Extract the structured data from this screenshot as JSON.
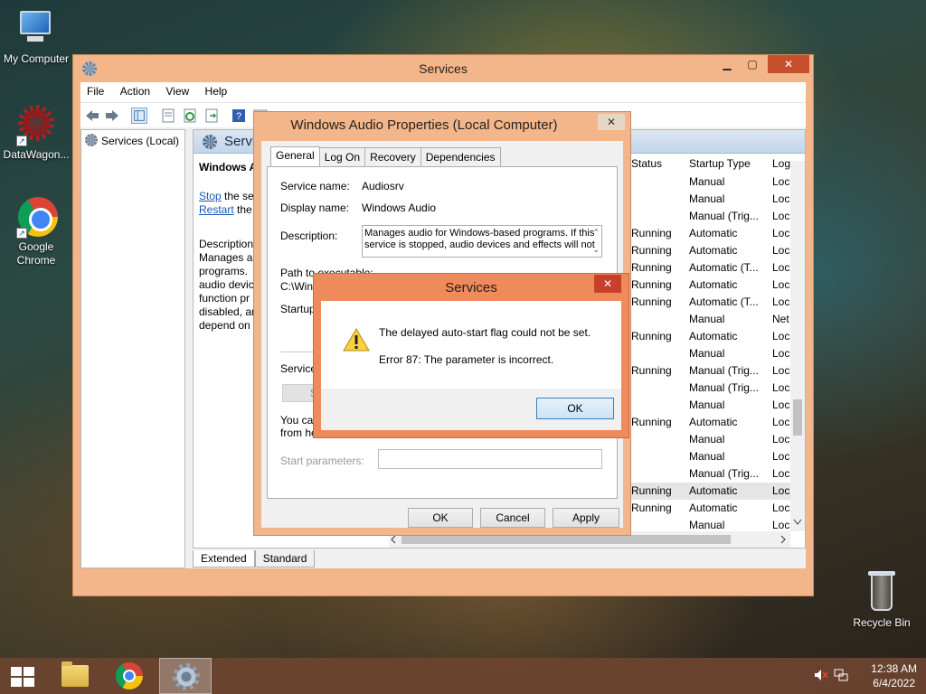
{
  "desktop": {
    "icons": [
      {
        "label": "My Computer"
      },
      {
        "label": "DataWagon..."
      },
      {
        "label": "Google Chrome"
      },
      {
        "label": "Recycle Bin"
      }
    ]
  },
  "services_window": {
    "title": "Services",
    "menu": [
      "File",
      "Action",
      "View",
      "Help"
    ],
    "tree_root": "Services (Local)",
    "detail_header": "Servi",
    "service_title": "Windows A",
    "actions": {
      "stop_link": "Stop",
      "stop_rest": " the ser",
      "restart_link": "Restart",
      "restart_rest": " the"
    },
    "description_lines": [
      "Description",
      "Manages au",
      "programs.",
      "audio devic",
      "function pr",
      "disabled, ar",
      "depend on"
    ],
    "columns": {
      "status": "Status",
      "startup_type": "Startup Type",
      "log_on": "Log"
    },
    "rows": [
      {
        "status": "",
        "startup": "Manual",
        "log": "Loc"
      },
      {
        "status": "",
        "startup": "Manual",
        "log": "Loc"
      },
      {
        "status": "",
        "startup": "Manual (Trig...",
        "log": "Loc"
      },
      {
        "status": "Running",
        "startup": "Automatic",
        "log": "Loc"
      },
      {
        "status": "Running",
        "startup": "Automatic",
        "log": "Loc"
      },
      {
        "status": "Running",
        "startup": "Automatic (T...",
        "log": "Loc"
      },
      {
        "status": "Running",
        "startup": "Automatic",
        "log": "Loc"
      },
      {
        "status": "Running",
        "startup": "Automatic (T...",
        "log": "Loc"
      },
      {
        "status": "",
        "startup": "Manual",
        "log": "Net"
      },
      {
        "status": "Running",
        "startup": "Automatic",
        "log": "Loc"
      },
      {
        "status": "",
        "startup": "Manual",
        "log": "Loc"
      },
      {
        "status": "Running",
        "startup": "Manual (Trig...",
        "log": "Loc"
      },
      {
        "status": "",
        "startup": "Manual (Trig...",
        "log": "Loc"
      },
      {
        "status": "",
        "startup": "Manual",
        "log": "Loc"
      },
      {
        "status": "Running",
        "startup": "Automatic",
        "log": "Loc"
      },
      {
        "status": "",
        "startup": "Manual",
        "log": "Loc"
      },
      {
        "status": "",
        "startup": "Manual",
        "log": "Loc"
      },
      {
        "status": "",
        "startup": "Manual (Trig...",
        "log": "Loc"
      },
      {
        "status": "Running",
        "startup": "Automatic",
        "log": "Loc",
        "selected": true
      },
      {
        "status": "Running",
        "startup": "Automatic",
        "log": "Loc"
      },
      {
        "status": "",
        "startup": "Manual",
        "log": "Loc"
      }
    ],
    "bottom_tabs": [
      "Extended",
      "Standard"
    ]
  },
  "properties_dialog": {
    "title": "Windows Audio Properties (Local Computer)",
    "tabs": [
      "General",
      "Log On",
      "Recovery",
      "Dependencies"
    ],
    "service_name_label": "Service name:",
    "service_name": "Audiosrv",
    "display_name_label": "Display name:",
    "display_name": "Windows Audio",
    "description_label": "Description:",
    "description_line1": "Manages audio for Windows-based programs.  If this",
    "description_line2": "service is stopped, audio devices and effects will not",
    "path_label": "Path to executable:",
    "path_value": "C:\\Wind",
    "startup_label": "Startup",
    "service_status_label": "Service",
    "start_btn_partial": "S",
    "hint_line1": "You car",
    "hint_line2": "from here.",
    "start_params_label": "Start parameters:",
    "buttons": {
      "ok": "OK",
      "cancel": "Cancel",
      "apply": "Apply"
    }
  },
  "error_dialog": {
    "title": "Services",
    "message": "The delayed auto-start flag could not be set.",
    "error": "Error 87: The parameter is incorrect.",
    "ok": "OK"
  },
  "taskbar": {
    "time": "12:38 AM",
    "date": "6/4/2022"
  }
}
